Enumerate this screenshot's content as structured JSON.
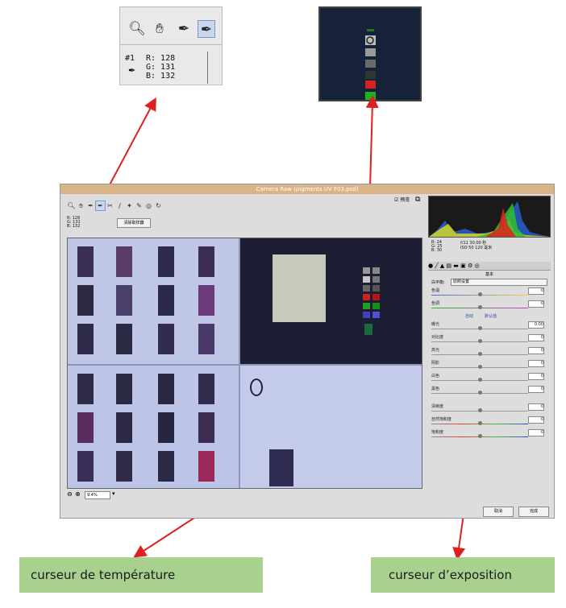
{
  "zoom_inset": {
    "tools": [
      "zoom-icon",
      "hand-icon",
      "white-balance-dropper-icon",
      "color-sampler-icon"
    ],
    "sample_index": "#1",
    "r_label": "R: 128",
    "g_label": "G: 131",
    "b_label": "B: 132"
  },
  "window": {
    "title": "Camera Raw (pigments UV F03.psd)",
    "preview_label": "预览",
    "clear_samplers_label": "清除取样器",
    "zoom_value": "9.4%",
    "readout": [
      "R: 128",
      "G: 131",
      "B: 132"
    ],
    "hist_readout": [
      "R: 24",
      "G: 25",
      "B: 30"
    ],
    "hist_exif": [
      "f/11  30.00 秒",
      "ISO 50  120 毫米"
    ],
    "panel_title": "基本",
    "white_balance_label": "白平衡:",
    "white_balance_value": "原照设置",
    "auto_label": "自动",
    "default_label": "默认值",
    "sliders": [
      {
        "label": "色温",
        "value": "0"
      },
      {
        "label": "色调",
        "value": "0"
      },
      {
        "label": "曝光",
        "value": "0.00"
      },
      {
        "label": "对比度",
        "value": "0"
      },
      {
        "label": "高光",
        "value": "0"
      },
      {
        "label": "阴影",
        "value": "0"
      },
      {
        "label": "白色",
        "value": "0"
      },
      {
        "label": "黑色",
        "value": "0"
      },
      {
        "label": "清晰度",
        "value": "0"
      },
      {
        "label": "自然饱和度",
        "value": "0"
      },
      {
        "label": "饱和度",
        "value": "0"
      }
    ],
    "cancel_label": "取消",
    "done_label": "完成"
  },
  "callouts": {
    "temperature": "curseur de température",
    "exposure": "curseur d’exposition"
  },
  "colors": {
    "titlebar": "#d9b486",
    "callout_bg": "#a9d18e",
    "arrow": "#e02020"
  }
}
